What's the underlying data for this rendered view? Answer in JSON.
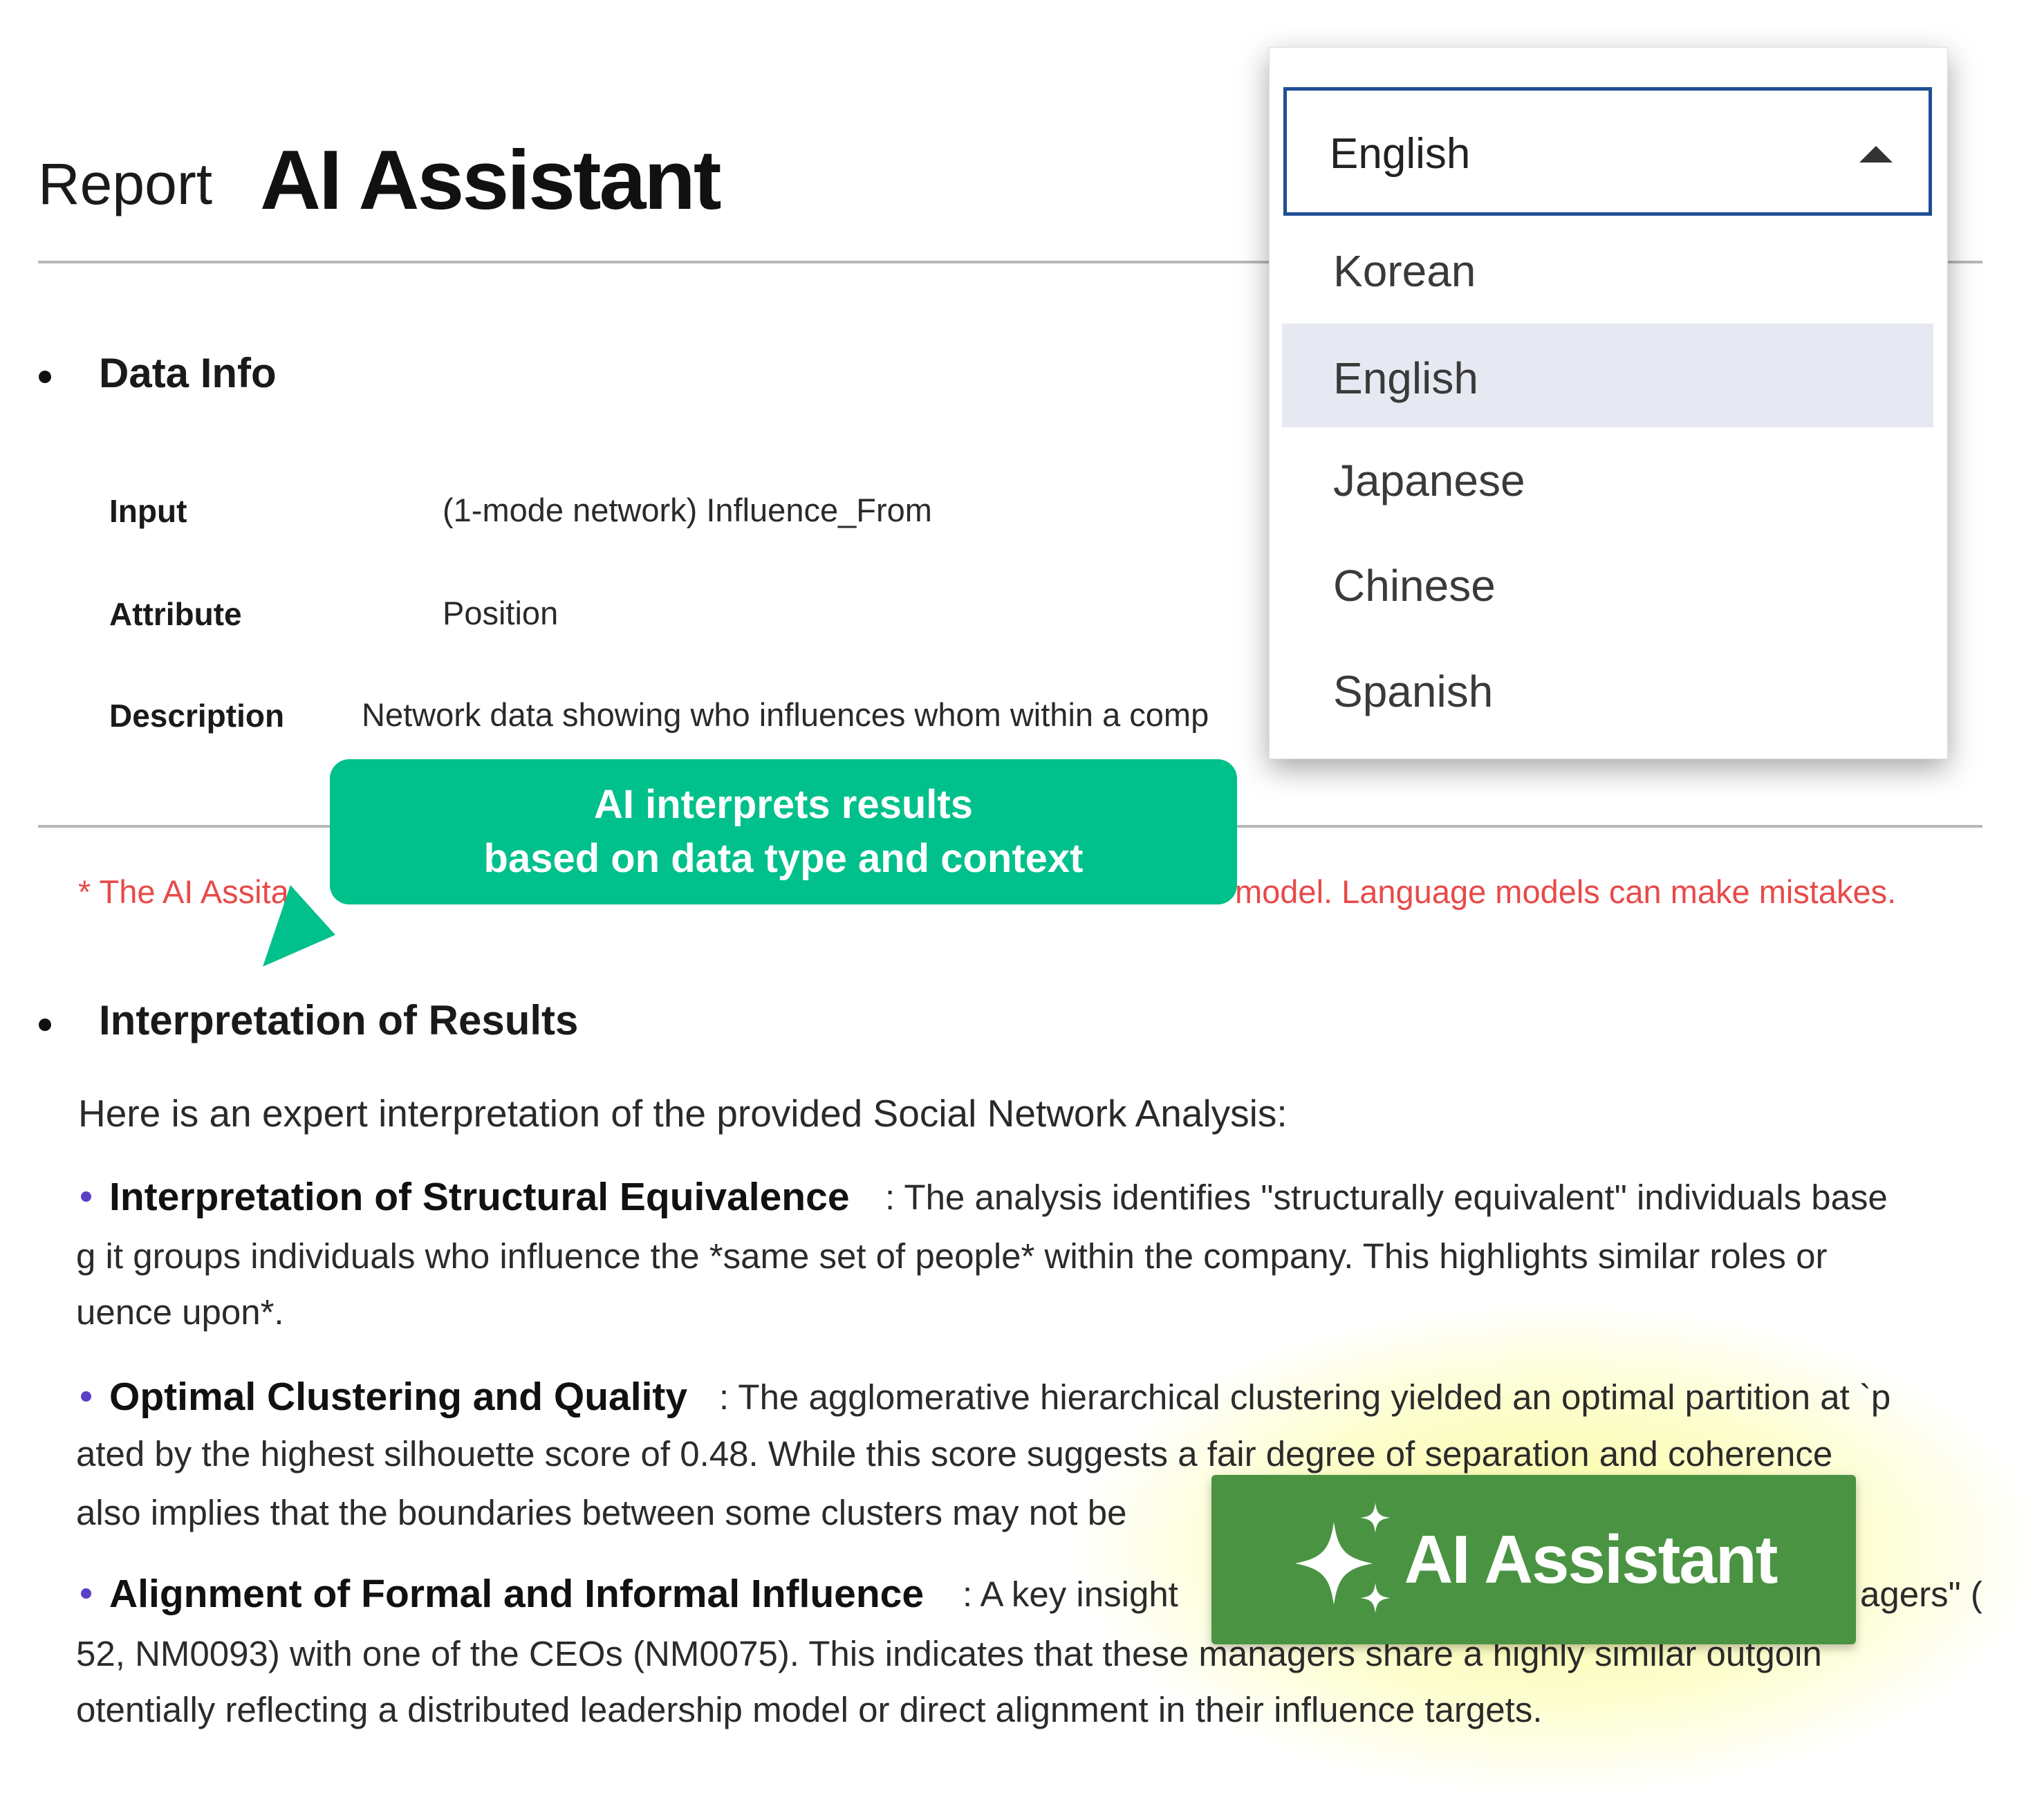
{
  "header": {
    "report_word": "Report",
    "title": "AI Assistant"
  },
  "data_info": {
    "heading": "Data Info",
    "rows": [
      {
        "label": "Input",
        "value": "(1-mode network) Influence_From"
      },
      {
        "label": "Attribute",
        "value": "Position"
      },
      {
        "label": "Description",
        "value": "Network data showing who influences whom within a comp"
      }
    ]
  },
  "callout": {
    "line1": "AI interprets results",
    "line2": "based on data type and context"
  },
  "disclaimer": {
    "left": "* The AI Assi",
    "left_tail": "ta",
    "right": "model. Language models can make mistakes."
  },
  "interpretation": {
    "heading": "Interpretation of Results",
    "intro": "Here is an expert interpretation of the provided Social Network Analysis:",
    "items": [
      {
        "title": "Interpretation of Structural Equivalence",
        "line1": ": The analysis identifies \"structurally equivalent\" individuals base",
        "line2": "g it groups individuals who influence the *same set of people* within the company. This highlights similar roles or",
        "line3": "uence upon*."
      },
      {
        "title": "Optimal Clustering and Quality",
        "line1": ": The agglomerative hierarchical clustering yielded an optimal partition at `p",
        "line2": "ated by the highest silhouette score of 0.48. While this score suggests a fair degree of separation and coherence",
        "line3": "also implies that the boundaries between some clusters may not be"
      },
      {
        "title": "Alignment of Formal and Informal Influence",
        "line1": ": A key insight",
        "line1_right": "agers\" (",
        "line2": "52, NM0093) with one of the CEOs (NM0075). This indicates that these managers share a highly similar outgoin",
        "line3": "otentially reflecting a distributed leadership model or direct alignment in their influence targets."
      }
    ]
  },
  "ai_badge": {
    "label": "AI Assistant",
    "icon": "sparkle-icon",
    "color": "#4a9342"
  },
  "language_select": {
    "selected": "English",
    "options": [
      "Korean",
      "English",
      "Japanese",
      "Chinese",
      "Spanish"
    ]
  },
  "colors": {
    "callout": "#00c08b",
    "disclaimer": "#e84a4a",
    "select_border": "#1f4e94",
    "item_bullet": "#5b3fc4"
  }
}
